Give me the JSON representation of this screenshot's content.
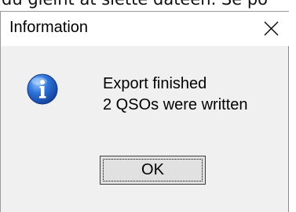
{
  "background": {
    "text": "du gleint at siette dateen. Se po"
  },
  "dialog": {
    "title": "Information",
    "close_symbol": "×",
    "icon": "info-icon",
    "message_line1": "Export finished",
    "message_line2": "2 QSOs were  written",
    "ok_label": "OK"
  },
  "colors": {
    "dialog_bg": "#f0f0f0",
    "titlebar_bg": "#ffffff",
    "icon_blue": "#1f5fc4",
    "button_bg": "#e1e1e1"
  }
}
